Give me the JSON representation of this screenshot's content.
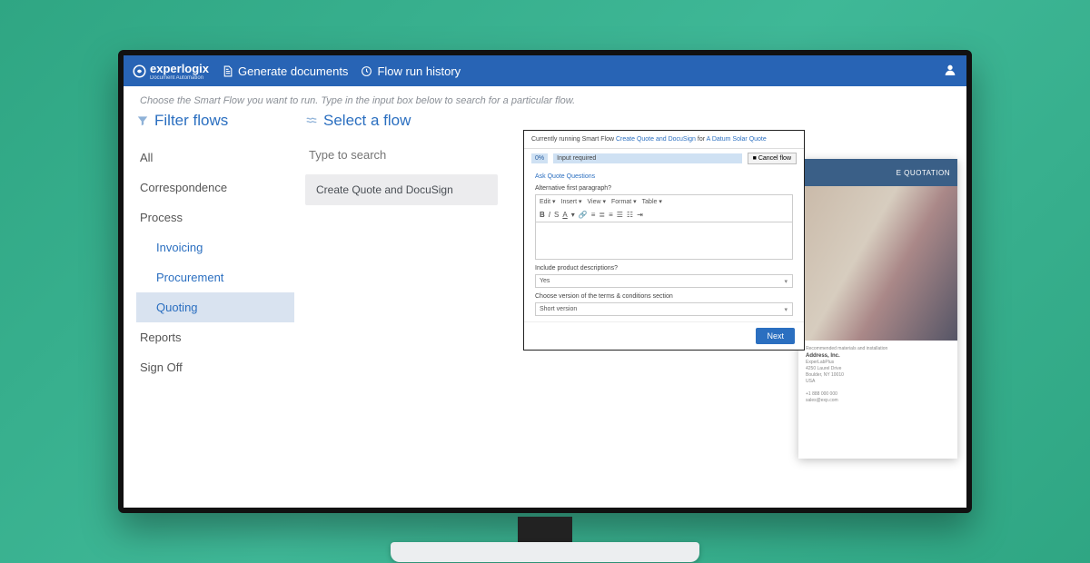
{
  "brand": {
    "name": "experlogix",
    "tagline": "Document Automation"
  },
  "nav": {
    "generate": "Generate documents",
    "history": "Flow run history"
  },
  "instruction": "Choose the Smart Flow you want to run. Type in the input box below to search for a particular flow.",
  "filter": {
    "title": "Filter flows",
    "items": [
      "All",
      "Correspondence",
      "Process"
    ],
    "process_children": [
      "Invoicing",
      "Procurement",
      "Quoting"
    ],
    "items_after": [
      "Reports",
      "Sign Off"
    ],
    "active": "Quoting"
  },
  "select": {
    "title": "Select a flow",
    "search_placeholder": "Type to search",
    "flows": [
      "Create Quote and DocuSign"
    ]
  },
  "modal": {
    "running_prefix": "Currently running Smart Flow",
    "flow_link": "Create Quote and DocuSign",
    "for_word": "for",
    "subject": "A Datum Solar Quote",
    "progress_pct": "0%",
    "progress_label": "Input required",
    "cancel": "Cancel flow",
    "section": "Ask Quote Questions",
    "q1": "Alternative first paragraph?",
    "toolbar": [
      "Edit ▾",
      "Insert ▾",
      "View ▾",
      "Format ▾",
      "Table ▾"
    ],
    "q2": "Include product descriptions?",
    "q2_value": "Yes",
    "q3": "Choose version of the terms & conditions section",
    "q3_value": "Short version",
    "next": "Next"
  },
  "doc": {
    "banner": "E QUOTATION",
    "line1": "Recommended materials and installation",
    "line2": "Address, Inc.",
    "addr1": "ExperLabPlus",
    "addr2": "4250 Laurel Drive",
    "addr3": "Boulder, NY 10010",
    "addr4": "USA",
    "phone": "+1 888 000 000",
    "email": "sales@exp.com"
  }
}
